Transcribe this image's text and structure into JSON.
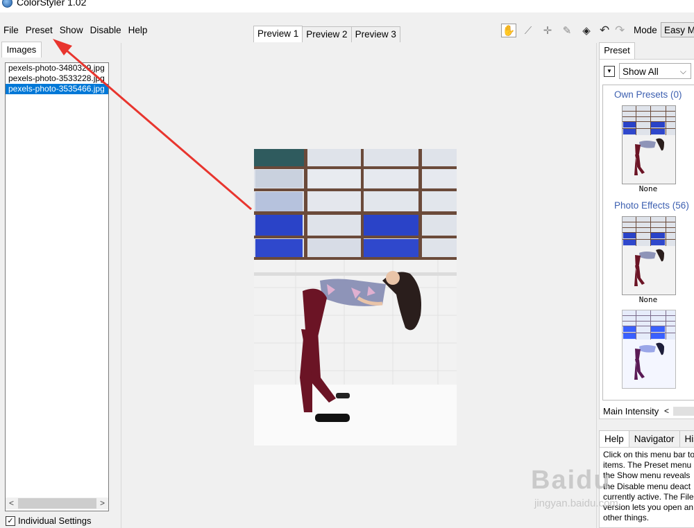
{
  "window": {
    "title": "ColorStyler 1.02"
  },
  "menu": [
    "File",
    "Preset",
    "Show",
    "Disable",
    "Help"
  ],
  "left_panel": {
    "tab": "Images",
    "files": [
      "pexels-photo-3480329.jpg",
      "pexels-photo-3533228.jpg",
      "pexels-photo-3535466.jpg"
    ],
    "selected_index": 2,
    "individual_settings_label": "Individual Settings",
    "individual_settings_checked": true
  },
  "preview_tabs": [
    "Preview 1",
    "Preview 2",
    "Preview 3"
  ],
  "toolbar": {
    "tools": [
      "hand-icon",
      "eyedropper-icon",
      "crosshair-icon",
      "brush-icon",
      "split-compare-icon"
    ],
    "active_tool": "hand-icon",
    "undo_glyph": "↶",
    "redo_glyph": "↷",
    "mode_label": "Mode",
    "mode_value": "Easy Mode"
  },
  "right_panel": {
    "tab": "Preset",
    "show_value": "Show All",
    "groups": [
      {
        "title": "Own Presets (0)",
        "caption": "None"
      },
      {
        "title": "Photo Effects (56)",
        "caption": "None"
      }
    ],
    "main_intensity_label": "Main Intensity",
    "help_tabs": [
      "Help",
      "Navigator",
      "History"
    ],
    "help_text": [
      "Click on this menu bar to",
      "items. The Preset menu",
      "the Show menu reveals",
      "the Disable menu deact",
      "currently active. The File",
      "version lets you open an",
      "other things."
    ]
  },
  "watermark": {
    "brand": "Baidu",
    "sub": "jingyan.baidu.com"
  },
  "colors": {
    "selection": "#0078d7",
    "preset_group": "#3c5fb0",
    "annotation_arrow": "#e8352e"
  }
}
